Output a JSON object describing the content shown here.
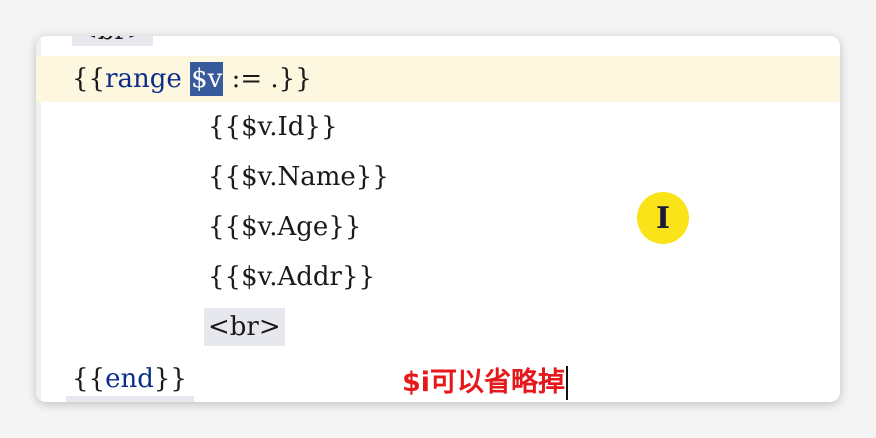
{
  "editor": {
    "top_partial_tag": "<br>",
    "lines": {
      "range_open_1": "{{",
      "range_keyword": "range",
      "range_var": "$v",
      "range_rest": " := .}}",
      "id": "{{$v.Id}}",
      "name": "{{$v.Name}}",
      "age": "{{$v.Age}}",
      "addr": "{{$v.Addr}}",
      "br": "<br>",
      "end_open": "{{",
      "end_keyword": "end",
      "end_close": "}}"
    }
  },
  "cursor": {
    "icon": "text-cursor-icon",
    "glyph": "I",
    "highlight_color": "#fbe319"
  },
  "annotation": {
    "text": "$i可以省略掉",
    "color": "#e5191b"
  },
  "colors": {
    "keyword": "#0b2e8a",
    "selection": "#375a9c",
    "current_line": "#fdf7df"
  }
}
